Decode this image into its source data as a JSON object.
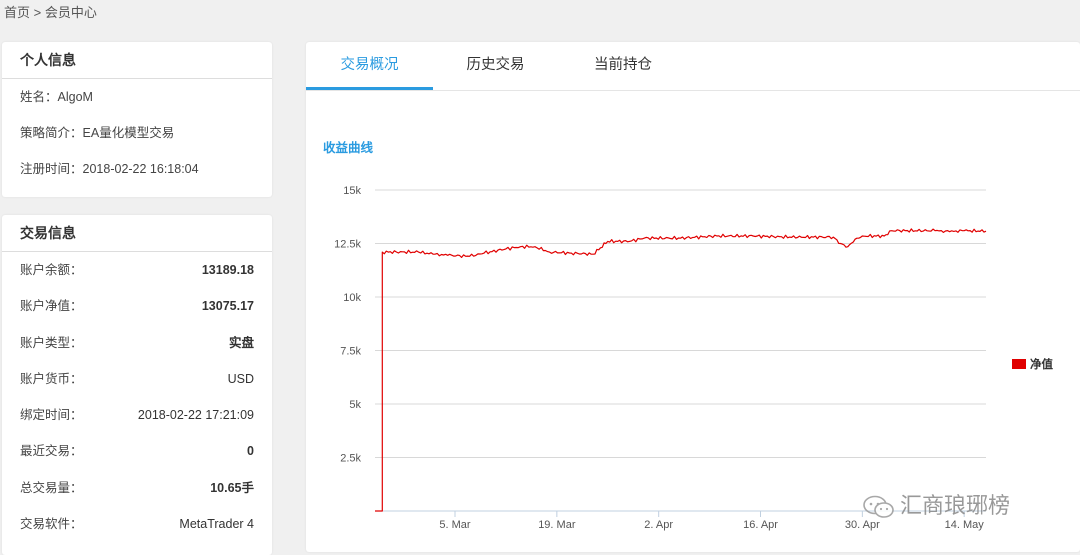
{
  "breadcrumb": "首页 > 会员中心",
  "personal": {
    "title": "个人信息",
    "rows": [
      {
        "label": "姓名：",
        "value": "AlgoM"
      },
      {
        "label": "策略简介：",
        "value": "EA量化模型交易"
      },
      {
        "label": "注册时间：",
        "value": "2018-02-22 16:18:04"
      }
    ]
  },
  "trade": {
    "title": "交易信息",
    "rows": [
      {
        "label": "账户余额：",
        "value": "13189.18"
      },
      {
        "label": "账户净值：",
        "value": "13075.17"
      },
      {
        "label": "账户类型：",
        "value": "实盘"
      },
      {
        "label": "账户货币：",
        "value": "USD"
      },
      {
        "label": "绑定时间：",
        "value": "2018-02-22 17:21:09"
      },
      {
        "label": "最近交易：",
        "value": "0"
      },
      {
        "label": "总交易量：",
        "value": "10.65手"
      },
      {
        "label": "交易软件：",
        "value": "MetaTrader 4"
      }
    ]
  },
  "tabs": [
    {
      "label": "交易概况",
      "active": true
    },
    {
      "label": "历史交易",
      "active": false
    },
    {
      "label": "当前持仓",
      "active": false
    }
  ],
  "chart_title": "收益曲线",
  "watermark": "汇商琅琊榜",
  "colors": {
    "accent": "#2a9be0",
    "series": "#e00000"
  },
  "chart_data": {
    "type": "line",
    "title": "收益曲线",
    "xlabel": "",
    "ylabel": "",
    "ylim": [
      0,
      15000
    ],
    "yticks": [
      2500,
      5000,
      7500,
      10000,
      12500,
      15000
    ],
    "ytick_labels": [
      "2.5k",
      "5k",
      "7.5k",
      "10k",
      "12.5k",
      "15k"
    ],
    "xlim": [
      "2018-02-22",
      "2018-05-17"
    ],
    "xticks": [
      "2018-03-05",
      "2018-03-19",
      "2018-04-02",
      "2018-04-16",
      "2018-04-30",
      "2018-05-14"
    ],
    "xtick_labels": [
      "5. Mar",
      "19. Mar",
      "2. Apr",
      "16. Apr",
      "30. Apr",
      "14. May"
    ],
    "grid": true,
    "legend_position": "right",
    "series": [
      {
        "name": "净值",
        "color": "#e00000",
        "points": [
          [
            "2018-02-22",
            0
          ],
          [
            "2018-02-23",
            0
          ],
          [
            "2018-02-23",
            12100
          ],
          [
            "2018-02-28",
            12100
          ],
          [
            "2018-03-02",
            12000
          ],
          [
            "2018-03-04",
            11950
          ],
          [
            "2018-03-07",
            11900
          ],
          [
            "2018-03-09",
            12050
          ],
          [
            "2018-03-12",
            12250
          ],
          [
            "2018-03-14",
            12350
          ],
          [
            "2018-03-16",
            12350
          ],
          [
            "2018-03-18",
            12100
          ],
          [
            "2018-03-21",
            12050
          ],
          [
            "2018-03-24",
            12000
          ],
          [
            "2018-03-25",
            12300
          ],
          [
            "2018-03-26",
            12600
          ],
          [
            "2018-03-29",
            12600
          ],
          [
            "2018-03-31",
            12750
          ],
          [
            "2018-04-05",
            12750
          ],
          [
            "2018-04-10",
            12850
          ],
          [
            "2018-04-15",
            12850
          ],
          [
            "2018-04-20",
            12800
          ],
          [
            "2018-04-26",
            12800
          ],
          [
            "2018-04-27",
            12500
          ],
          [
            "2018-04-28",
            12350
          ],
          [
            "2018-04-29",
            12700
          ],
          [
            "2018-04-30",
            12850
          ],
          [
            "2018-05-03",
            12850
          ],
          [
            "2018-05-04",
            13100
          ],
          [
            "2018-05-10",
            13100
          ],
          [
            "2018-05-12",
            13050
          ],
          [
            "2018-05-14",
            13100
          ],
          [
            "2018-05-17",
            13075
          ]
        ]
      }
    ]
  }
}
